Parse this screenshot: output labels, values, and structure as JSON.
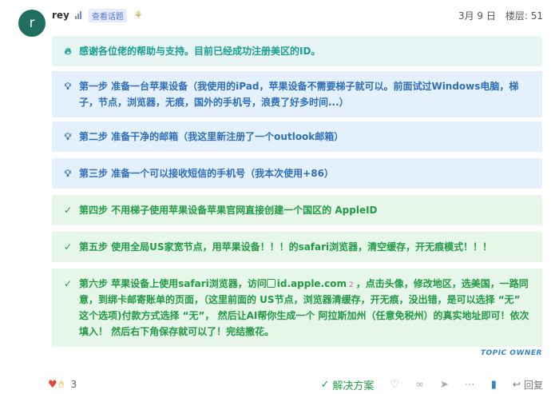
{
  "post": {
    "avatar_letter": "r",
    "username": "rey",
    "badge": "查看话题",
    "date": "3月 9 日",
    "floor": "楼层: 51"
  },
  "callouts": [
    "感谢各位佬的帮助与支持。目前已经成功注册美区的ID。",
    "第一步 准备一台苹果设备（我使用的iPad，苹果设备不需要梯子就可以。前面试过Windows电脑，梯子，节点，浏览器，无痕，国外的手机号，浪费了好多时间...）",
    "第二步 准备干净的邮箱（我这里新注册了一个outlook邮箱）",
    "第三步 准备一个可以接收短信的手机号（我本次使用+86）",
    "第四步 不用梯子使用苹果设备苹果官网直接创建一个国区的 AppleID",
    "第五步 使用全局US家宽节点，用苹果设备！！！的safari浏览器，清空缓存，开无痕模式！！！",
    {
      "before": "第六步 苹果设备上使用safari浏览器，访问",
      "link": "id.apple.com",
      "clicks": "2",
      "after": "，点击头像，修改地区，选美国，一路同意，到绑卡邮寄账单的页面，（这里前面的 US节点，浏览器清缓存，开无痕，没出错，是可以选择 “无” 这个选项)付款方式选择 “无”， 然后让AI帮你生成一个 阿拉斯加州（任意免税州）的真实地址即可！依次填入！ 然后右下角保存就可以了！完结撒花。"
    }
  ],
  "topic_owner": "TOPIC OWNER",
  "footer": {
    "reaction_count": "3",
    "solution_label": "解决方案",
    "reply_label": "回复"
  },
  "colors": {
    "teal": "#1a9e8d",
    "blue": "#2f6fb7",
    "green": "#239a45"
  }
}
